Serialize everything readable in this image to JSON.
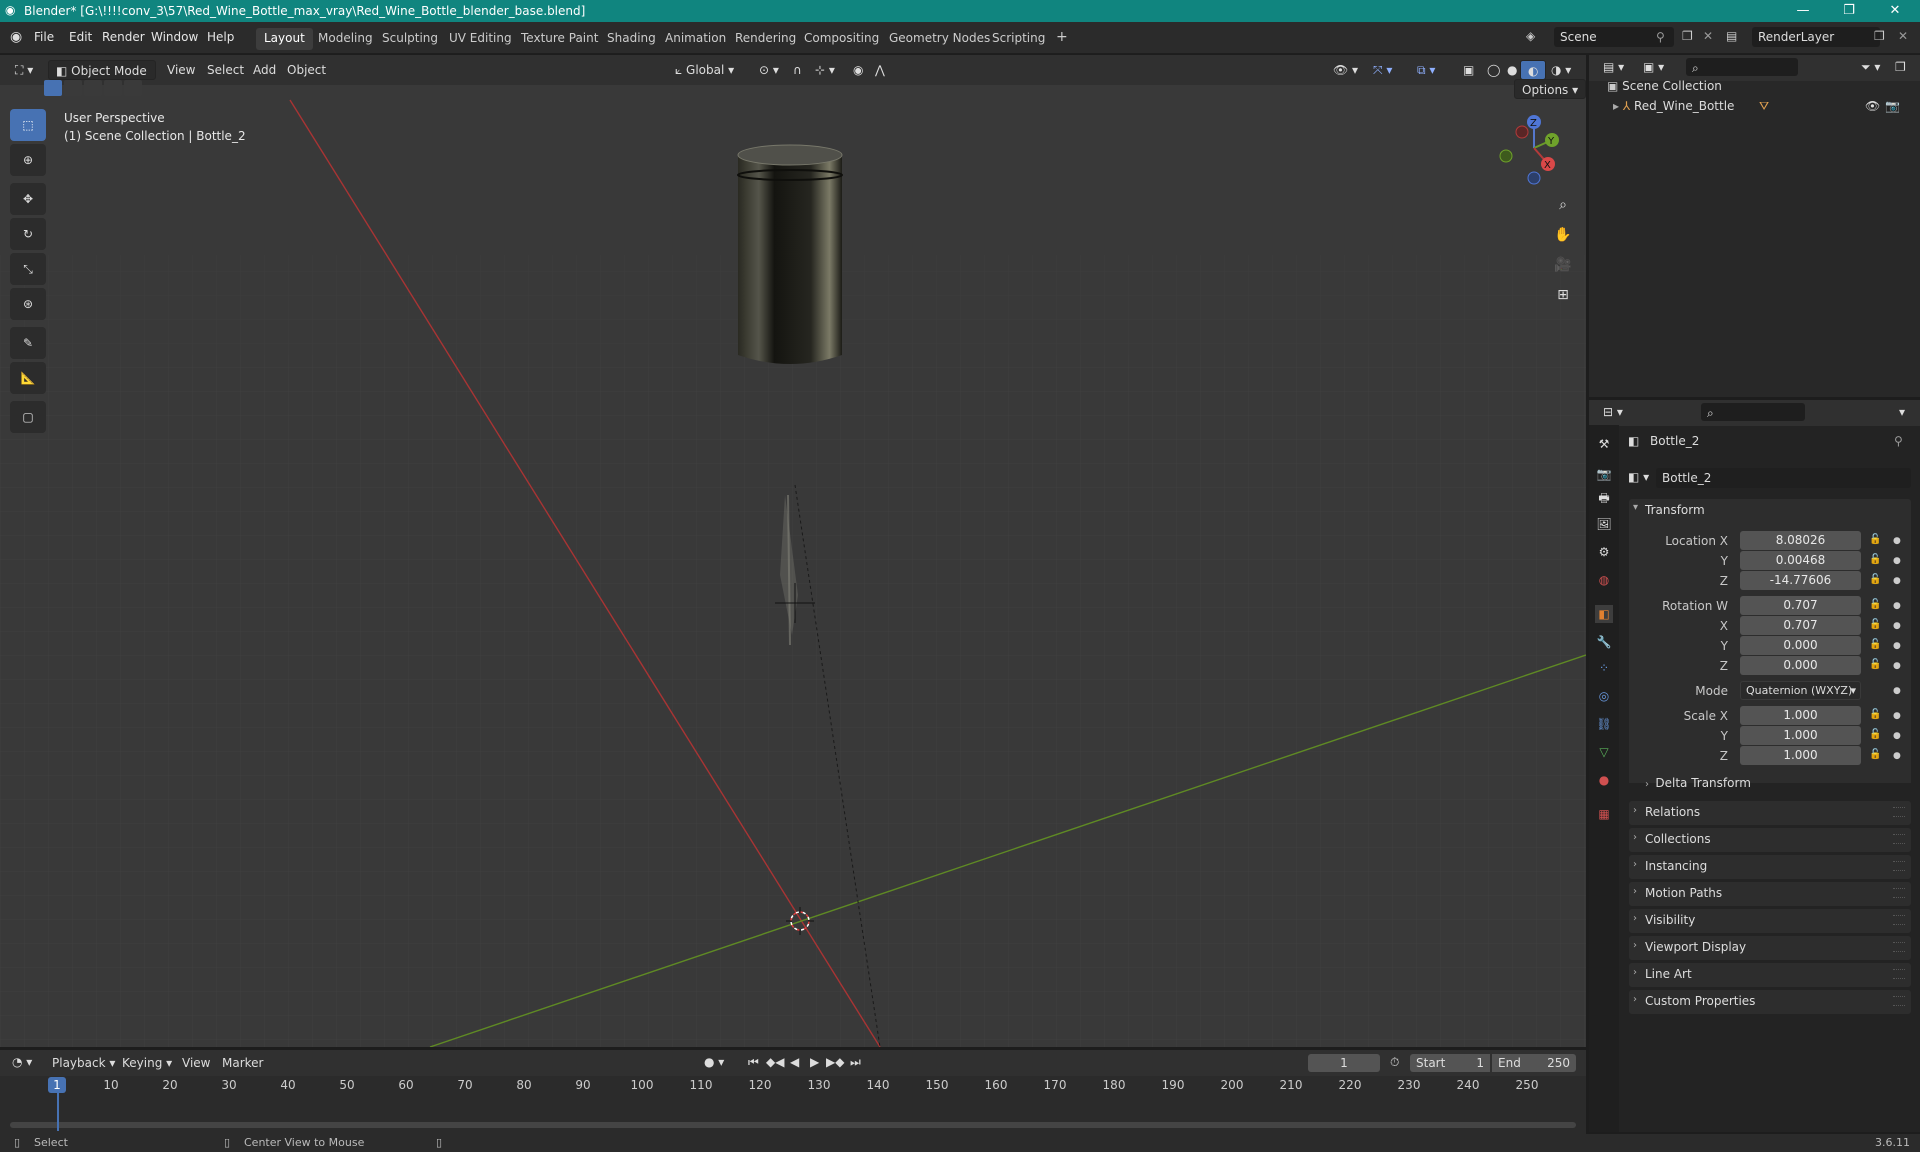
{
  "window": {
    "title": "Blender* [G:\\!!!!conv_3\\57\\Red_Wine_Bottle_max_vray\\Red_Wine_Bottle_blender_base.blend]"
  },
  "menu": {
    "items": [
      "File",
      "Edit",
      "Render",
      "Window",
      "Help"
    ]
  },
  "workspaces": [
    "Layout",
    "Modeling",
    "Sculpting",
    "UV Editing",
    "Texture Paint",
    "Shading",
    "Animation",
    "Rendering",
    "Compositing",
    "Geometry Nodes",
    "Scripting"
  ],
  "active_workspace": "Layout",
  "scene": {
    "name": "Scene"
  },
  "render_layer": {
    "name": "RenderLayer"
  },
  "viewport": {
    "mode": "Object Mode",
    "menus": [
      "View",
      "Select",
      "Add",
      "Object"
    ],
    "orientation": "Global",
    "options_label": "Options",
    "overlay_line1": "User Perspective",
    "overlay_line2": "(1) Scene Collection | Bottle_2",
    "gizmo_axes": {
      "x": "X",
      "y": "Y",
      "z": "Z"
    },
    "colors": {
      "x_axis": "#b33a3a",
      "y_axis": "#6a9a2a",
      "background": "#393939",
      "accent": "#4772b3"
    }
  },
  "outliner": {
    "root": "Scene Collection",
    "items": [
      {
        "name": "Red_Wine_Bottle"
      }
    ]
  },
  "properties": {
    "object_name": "Bottle_2",
    "datablock_name": "Bottle_2",
    "transform_header": "Transform",
    "location": {
      "label_x": "Location X",
      "label_y": "Y",
      "label_z": "Z",
      "x": "8.08026",
      "y": "0.00468",
      "z": "-14.77606"
    },
    "rotation": {
      "label_w": "Rotation W",
      "label_x": "X",
      "label_y": "Y",
      "label_z": "Z",
      "w": "0.707",
      "x": "0.707",
      "y": "0.000",
      "z": "0.000"
    },
    "mode_label": "Mode",
    "mode_value": "Quaternion (WXYZ)",
    "scale": {
      "label_x": "Scale X",
      "label_y": "Y",
      "label_z": "Z",
      "x": "1.000",
      "y": "1.000",
      "z": "1.000"
    },
    "delta_transform": "Delta Transform",
    "panels": [
      "Relations",
      "Collections",
      "Instancing",
      "Motion Paths",
      "Visibility",
      "Viewport Display",
      "Line Art",
      "Custom Properties"
    ]
  },
  "timeline": {
    "menus": [
      "Playback",
      "Keying",
      "View",
      "Marker"
    ],
    "current_frame": "1",
    "start_label": "Start",
    "start": "1",
    "end_label": "End",
    "end": "250",
    "ticks": [
      "1",
      "10",
      "20",
      "30",
      "40",
      "50",
      "60",
      "70",
      "80",
      "90",
      "100",
      "110",
      "120",
      "130",
      "140",
      "150",
      "160",
      "170",
      "180",
      "190",
      "200",
      "210",
      "220",
      "230",
      "240",
      "250"
    ]
  },
  "statusbar": {
    "select": "Select",
    "center_view": "Center View to Mouse",
    "version": "3.6.11"
  }
}
